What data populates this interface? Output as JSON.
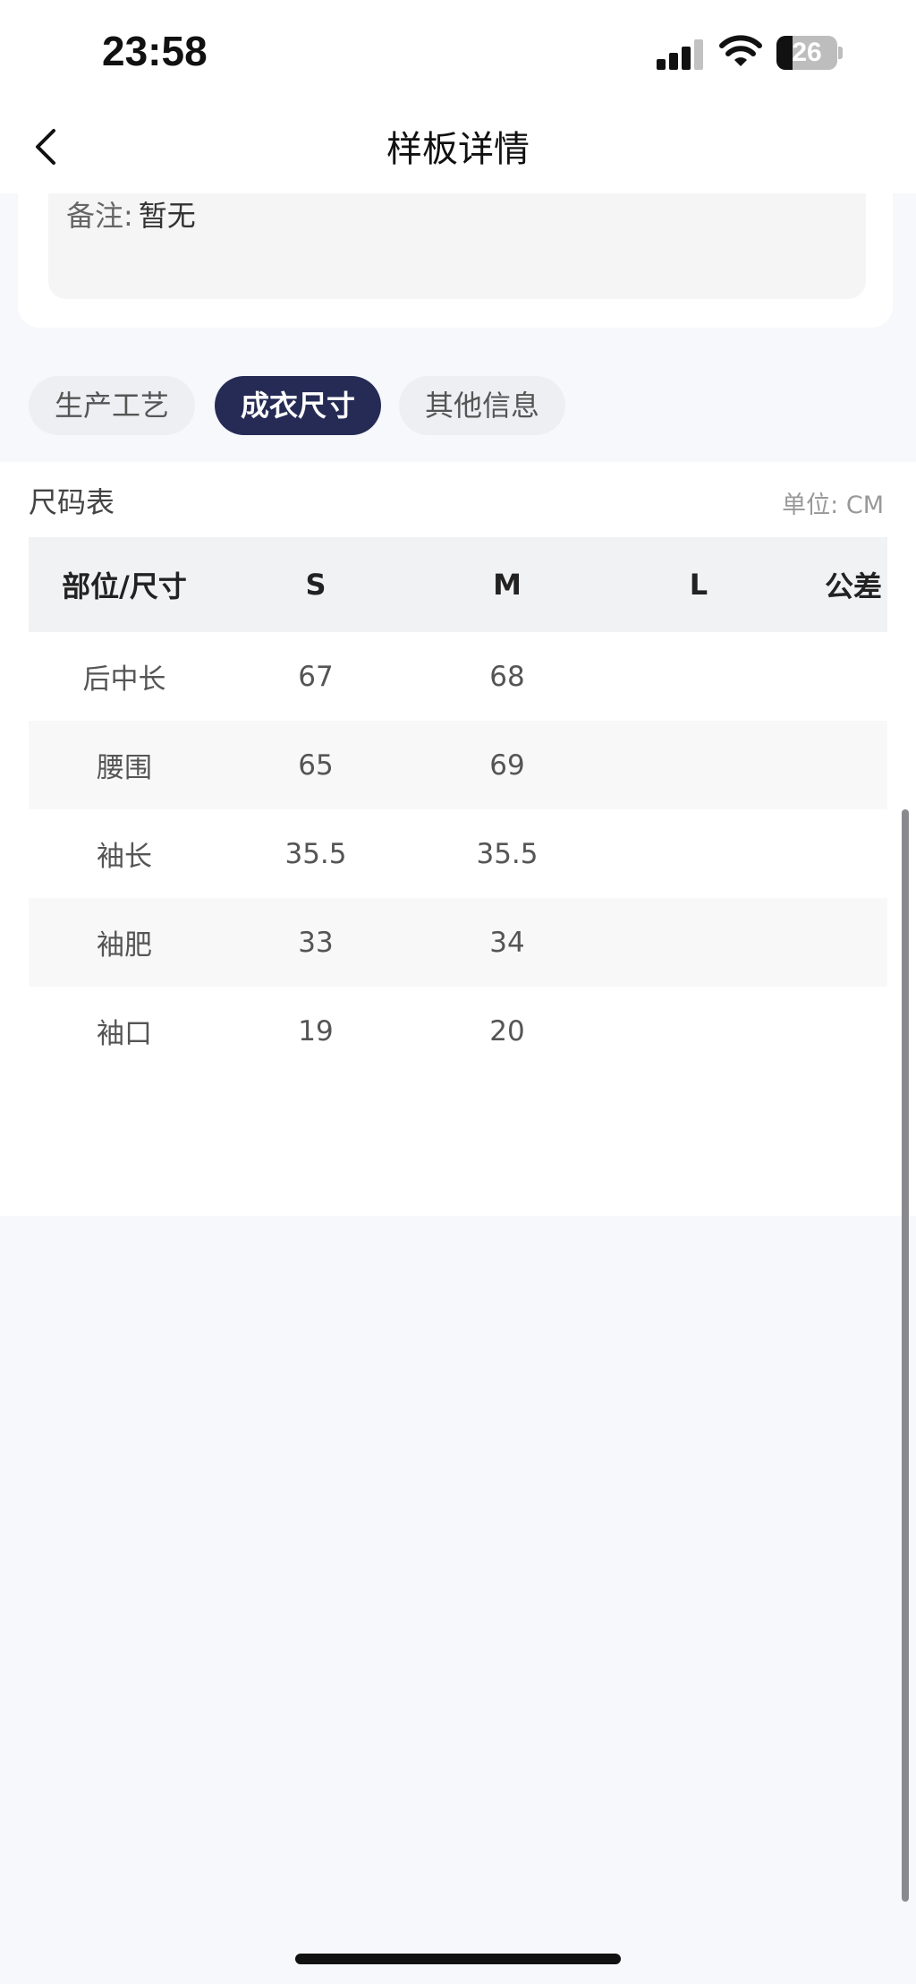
{
  "status_bar": {
    "time": "23:58",
    "battery": "26"
  },
  "nav": {
    "title": "样板详情"
  },
  "info": {
    "remark_label": "备注:",
    "remark_value": "暂无"
  },
  "tabs": [
    {
      "label": "生产工艺",
      "active": false
    },
    {
      "label": "成衣尺寸",
      "active": true
    },
    {
      "label": "其他信息",
      "active": false
    }
  ],
  "size_table": {
    "title": "尺码表",
    "unit": "单位: CM",
    "columns": [
      "部位/尺寸",
      "S",
      "M",
      "L",
      "公差"
    ],
    "rows": [
      [
        "后中长",
        "67",
        "68",
        "",
        ""
      ],
      [
        "腰围",
        "65",
        "69",
        "",
        ""
      ],
      [
        "袖长",
        "35.5",
        "35.5",
        "",
        ""
      ],
      [
        "袖肥",
        "33",
        "34",
        "",
        ""
      ],
      [
        "袖口",
        "19",
        "20",
        "",
        ""
      ]
    ]
  },
  "colors": {
    "accent": "#262b55",
    "page_bg": "#f7f8fc"
  }
}
